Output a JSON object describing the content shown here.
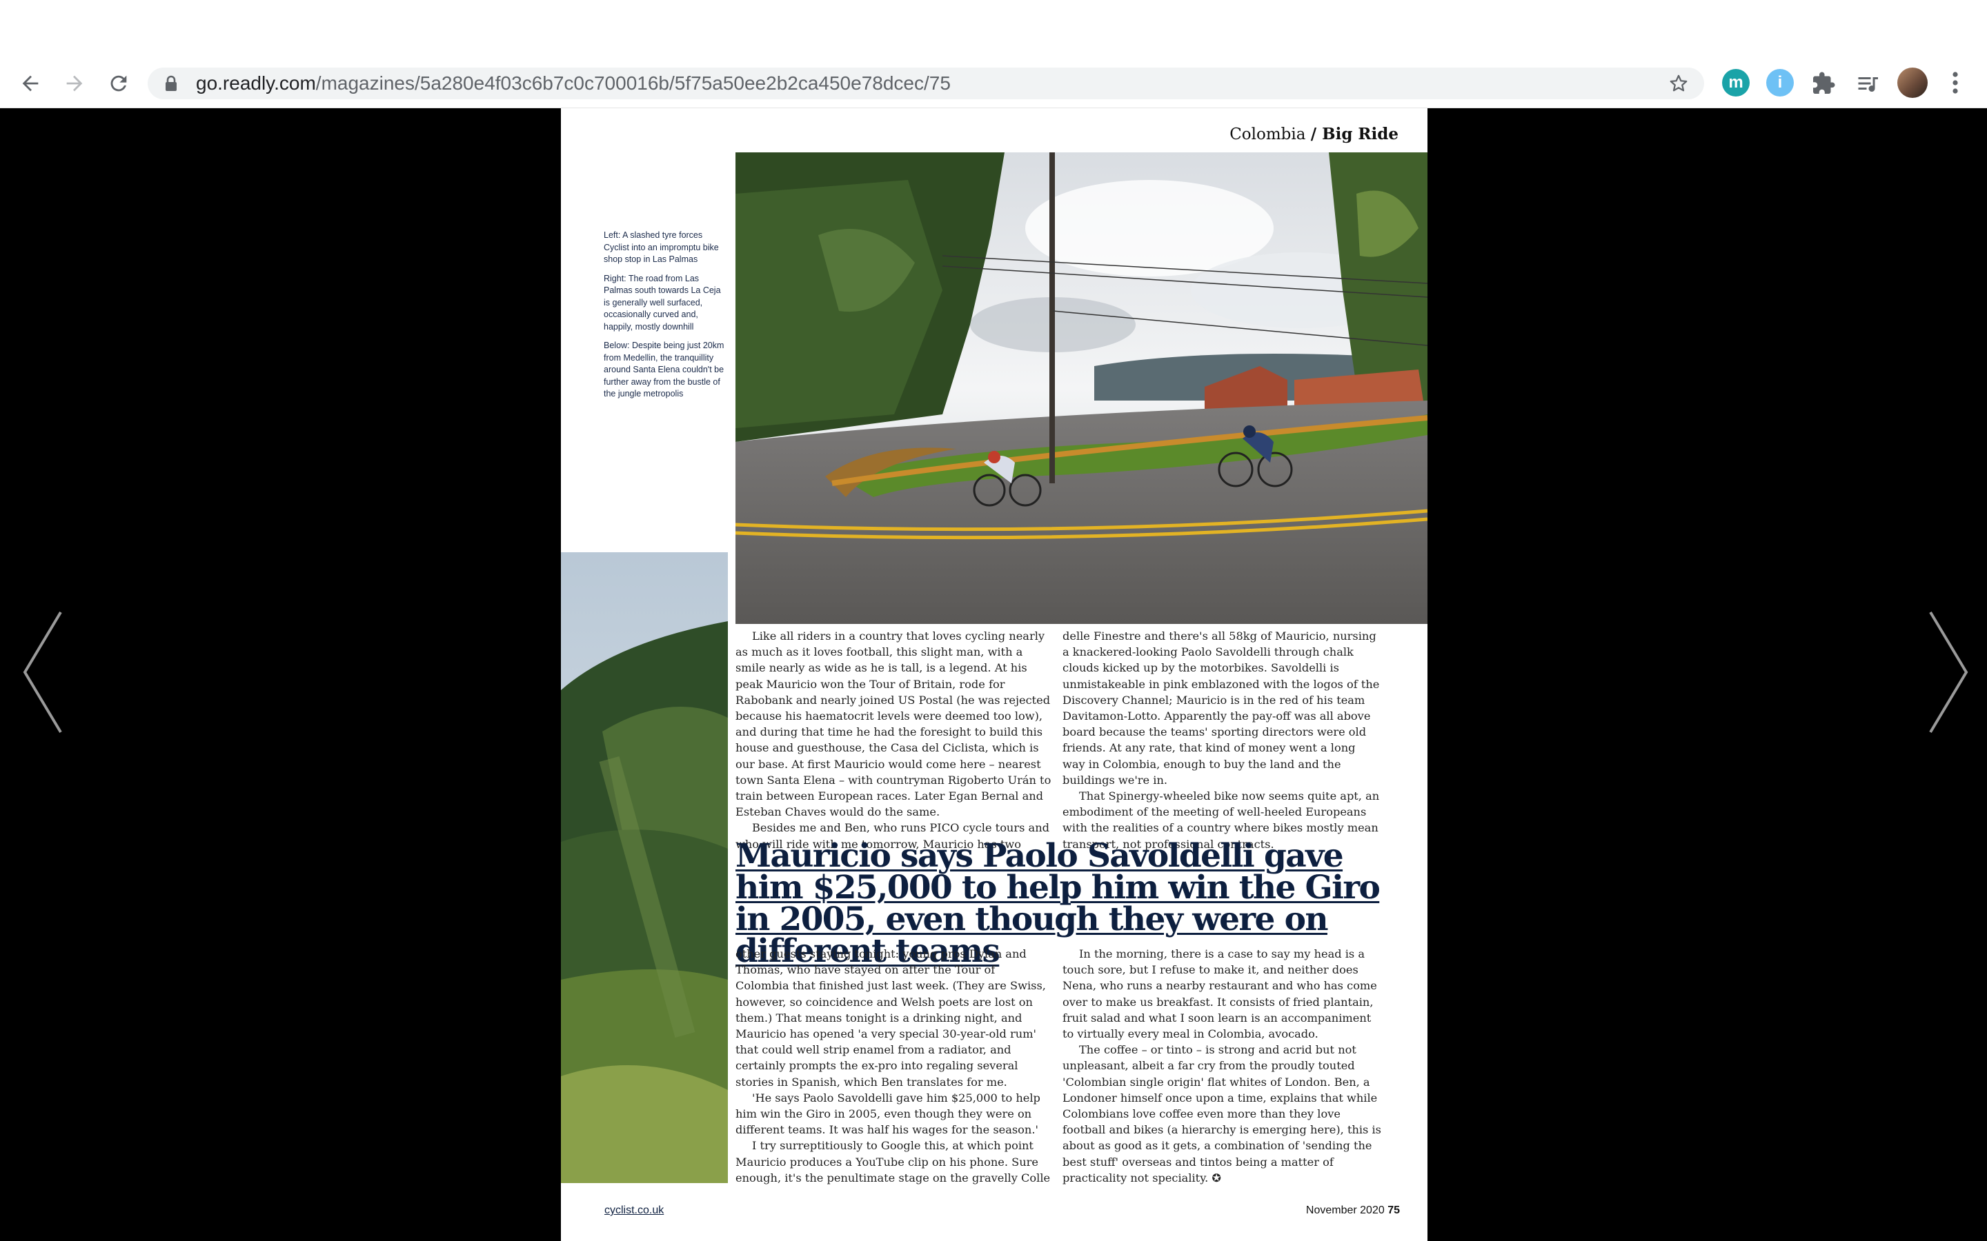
{
  "browser": {
    "url_host": "go.readly.com",
    "url_path": "/magazines/5a280e4f03c6b7c0c700016b/5f75a50ee2b2ca450e78dcec/75",
    "extensions": [
      {
        "name": "m",
        "color": "#1aa3a8"
      },
      {
        "name": "i",
        "color": "#6ec1f5"
      }
    ]
  },
  "page": {
    "running_head_country": "Colombia",
    "running_head_section": "/ Big Ride",
    "captions": [
      "Left: A slashed tyre forces Cyclist into an impromptu bike shop stop in Las Palmas",
      "Right: The road from Las Palmas south towards La Ceja is generally well surfaced, occasionally curved and, happily, mostly downhill",
      "Below: Despite being just 20km from Medellin, the tranquillity around Santa Elena couldn't be further away from the bustle of the jungle metropolis"
    ],
    "col_a1": [
      "Like all riders in a country that loves cycling nearly as much as it loves football, this slight man, with a smile nearly as wide as he is tall, is a legend. At his peak Mauricio won the Tour of Britain, rode for Rabobank and nearly joined US Postal (he was rejected because his haematocrit levels were deemed too low), and during that time he had the foresight to build this house and guesthouse, the Casa del Ciclista, which is our base. At first Mauricio would come here – nearest town Santa Elena – with countryman Rigoberto Urán to train between European races. Later Egan Bernal and Esteban Chaves would do the same.",
      "Besides me and Ben, who runs PICO cycle tours and who will ride with me tomorrow, Mauricio has two"
    ],
    "col_a2": [
      "delle Finestre and there's all 58kg of Mauricio, nursing a knackered-looking Paolo Savoldelli through chalk clouds kicked up by the motorbikes. Savoldelli is unmistakeable in pink emblazoned with the logos of the Discovery Channel; Mauricio is in the red of his team Davitamon-Lotto. Apparently the pay-off was all above board because the teams' sporting directors were old friends. At any rate, that kind of money went a long way in Colombia, enough to buy the land and the buildings we're in.",
      "That Spinergy-wheeled bike now seems quite apt, an embodiment of the meeting of well-heeled Europeans with the realities of a country where bikes mostly mean transport, not professional contracts."
    ],
    "pull_quote": "Mauricio says Paolo Savoldelli gave him $25,000 to help him win the Giro in 2005, even though they were on different teams",
    "col_b1": [
      "other guests staying tonight: young pros Dylan and Thomas, who have stayed on after the Tour of Colombia that finished just last week. (They are Swiss, however, so coincidence and Welsh poets are lost on them.) That means tonight is a drinking night, and Mauricio has opened 'a very special 30-year-old rum' that could well strip enamel from a radiator, and certainly prompts the ex-pro into regaling several stories in Spanish, which Ben translates for me.",
      "'He says Paolo Savoldelli gave him $25,000 to help him win the Giro in 2005, even though they were on different teams. It was half his wages for the season.'",
      "I try surreptitiously to Google this, at which point Mauricio produces a YouTube clip on his phone. Sure enough, it's the penultimate stage on the gravelly Colle"
    ],
    "col_b2": [
      "In the morning, there is a case to say my head is a touch sore, but I refuse to make it, and neither does Nena, who runs a nearby restaurant and who has come over to make us breakfast. It consists of fried plantain, fruit salad and what I soon learn is an accompaniment to virtually every meal in Colombia, avocado.",
      "The coffee – or tinto – is strong and acrid but not unpleasant, albeit a far cry from the proudly touted 'Colombian single origin' flat whites of London. Ben, a Londoner himself once upon a time, explains that while Colombians love coffee even more than they love football and bikes (a hierarchy is emerging here), this is about as good as it gets, a combination of 'sending the best stuff' overseas and tintos being a matter of practicality not speciality. ✪"
    ],
    "footer_site": "cyclist.co.uk",
    "footer_issue": "November 2020",
    "footer_page": "75"
  }
}
